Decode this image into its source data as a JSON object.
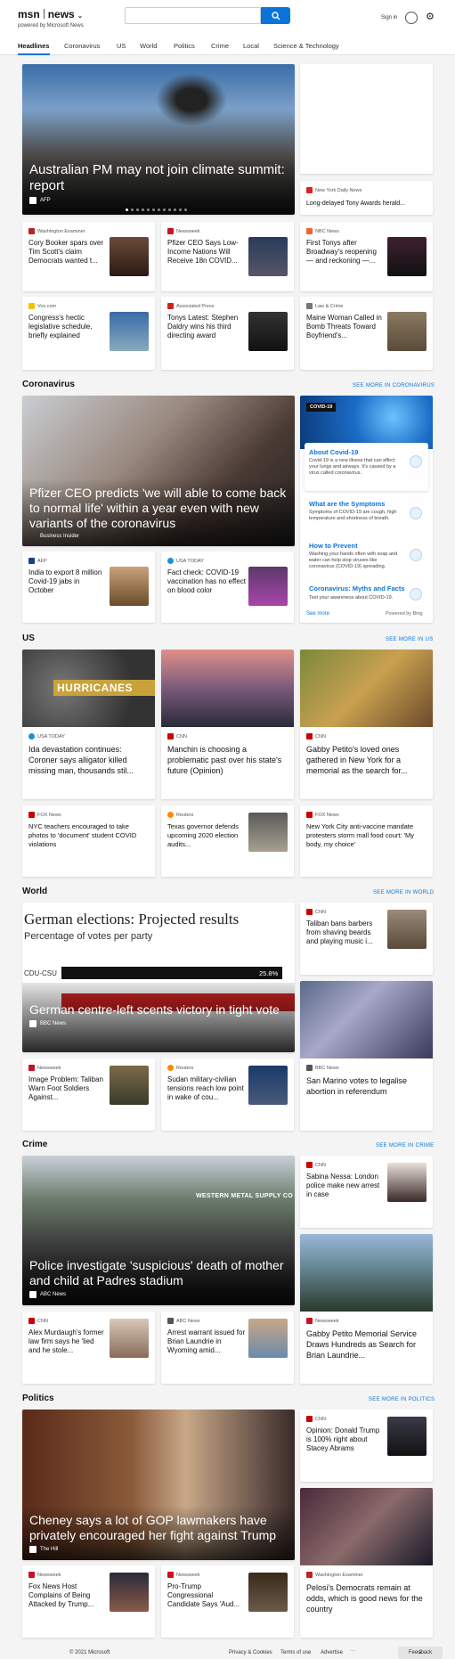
{
  "header": {
    "logo": "msn",
    "product": "news",
    "powered_by": "powered by Microsoft News",
    "search_placeholder": "",
    "signin": "Sign in"
  },
  "nav": [
    "Headlines",
    "Coronavirus",
    "US",
    "World",
    "Politics",
    "Crime",
    "Local",
    "Science & Technology"
  ],
  "hero": {
    "title": "Australian PM may not join climate summit: report",
    "source": "AFP"
  },
  "right_top": {
    "source": "New York Daily News",
    "title": "Long-delayed Tony Awards herald..."
  },
  "row1": [
    {
      "source": "Washington Examiner",
      "title": "Cory Booker spars over Tim Scott's claim Democrats wanted t..."
    },
    {
      "source": "Newsweek",
      "title": "Pfizer CEO Says Low-Income Nations Will Receive 18n COVID..."
    },
    {
      "source": "NBC News",
      "title": "First Tonys after Broadway's reopening — and reckoning —..."
    }
  ],
  "row2": [
    {
      "source": "Vox.com",
      "title": "Congress's hectic legislative schedule, briefly explained"
    },
    {
      "source": "Associated Press",
      "title": "Tonys Latest: Stephen Daldry wins his third directing award"
    },
    {
      "source": "Law & Crime",
      "title": "Maine Woman Called in Bomb Threats Toward Boyfriend's..."
    }
  ],
  "coronavirus": {
    "label": "Coronavirus",
    "see_more": "SEE MORE IN CORONAVIRUS",
    "hero": {
      "title": "Pfizer CEO predicts 'we will able to come back to normal life' within a year even with new variants of the coronavirus",
      "source": "Business Insider"
    },
    "cards": [
      {
        "source": "AFP",
        "title": "India to export 8 million Covid-19 jabs in October"
      },
      {
        "source": "USA TODAY",
        "title": "Fact check: COVID-19 vaccination has no effect on blood color"
      }
    ],
    "panel": {
      "badge": "COVID-19",
      "items": [
        {
          "title": "About Covid-19",
          "text": "Covid-19 is a new illness that can affect your lungs and airways. It's caused by a virus called coronavirus."
        },
        {
          "title": "What are the Symptoms",
          "text": "Symptoms of COVID-19 are cough, high temperature and shortness of breath."
        },
        {
          "title": "How to Prevent",
          "text": "Washing your hands often with soap and water can help stop viruses like coronavirus (COVID-19) spreading."
        },
        {
          "title": "Coronavirus: Myths and Facts",
          "text": "Test your awareness about COVID-19."
        }
      ],
      "see_more": "See more",
      "powered": "Powered by Bing"
    }
  },
  "us": {
    "label": "US",
    "see_more": "SEE MORE IN US",
    "image_text": "HURRICANES",
    "cards": [
      {
        "source": "USA TODAY",
        "title": "Ida devastation continues: Coroner says alligator killed missing man, thousands stil..."
      },
      {
        "source": "CNN",
        "title": "Manchin is choosing a problematic past over his state's future (Opinion)"
      },
      {
        "source": "CNN",
        "title": "Gabby Petito's loved ones gathered in New York for a memorial as the search for..."
      }
    ],
    "small": [
      {
        "source": "FOX News",
        "title": "NYC teachers encouraged to take photos to 'document' student COVID violations"
      },
      {
        "source": "Reuters",
        "title": "Texas governor defends upcoming 2020 election audits..."
      },
      {
        "source": "FOX News",
        "title": "New York City anti-vaccine mandate protesters storm mall food court: 'My body, my choice'"
      }
    ]
  },
  "world": {
    "label": "World",
    "see_more": "SEE MORE IN WORLD",
    "hero": {
      "chart_heading": "German elections: Projected results",
      "chart_sub": "Percentage of votes per party",
      "bar_label": "CDU-CSU",
      "bar_value": "25.8%",
      "title": "German centre-left scents victory in tight vote",
      "source": "BBC News"
    },
    "right": {
      "source": "CNN",
      "title": "Taliban bans barbers from shaving beards and playing music i..."
    },
    "right2": {
      "source": "BBC News",
      "title": "San Marino votes to legalise abortion in referendum"
    },
    "cards": [
      {
        "source": "Newsweek",
        "title": "Image Problem: Taliban Warn Foot Soldiers Against..."
      },
      {
        "source": "Reuters",
        "title": "Sudan military-civilian tensions reach low point in wake of cou..."
      }
    ]
  },
  "crime": {
    "label": "Crime",
    "see_more": "SEE MORE IN CRIME",
    "hero": {
      "title": "Police investigate 'suspicious' death of mother and child at Padres stadium",
      "source": "ABC News",
      "sign": "WESTERN METAL SUPPLY CO"
    },
    "right": {
      "source": "CNN",
      "title": "Sabina Nessa: London police make new arrest in case"
    },
    "right2": {
      "source": "Newsweek",
      "title": "Gabby Petito Memorial Service Draws Hundreds as Search for Brian Laundrie..."
    },
    "cards": [
      {
        "source": "CNN",
        "title": "Alex Murdaugh's former law firm says he 'lied and he stole..."
      },
      {
        "source": "ABC News",
        "title": "Arrest warrant issued for Brian Laundrie in Wyoming amid..."
      }
    ]
  },
  "politics": {
    "label": "Politics",
    "see_more": "SEE MORE IN POLITICS",
    "hero": {
      "title": "Cheney says a lot of GOP lawmakers have privately encouraged her fight against Trump",
      "source": "The Hill"
    },
    "right": {
      "source": "CNN",
      "title": "Opinion: Donald Trump is 100% right about Stacey Abrams"
    },
    "right2": {
      "source": "Washington Examiner",
      "title": "Pelosi's Democrats remain at odds, which is good news for the country"
    },
    "cards": [
      {
        "source": "Newsweek",
        "title": "Fox News Host Complains of Being Attacked by Trump..."
      },
      {
        "source": "Newsweek",
        "title": "Pro-Trump Congressional Candidate Says 'Aud..."
      }
    ]
  },
  "footer": {
    "copyright": "© 2021 Microsoft",
    "privacy": "Privacy & Cookies",
    "terms": "Terms of use",
    "advertise": "Advertise",
    "more": "···",
    "feedback": "Feedback"
  }
}
